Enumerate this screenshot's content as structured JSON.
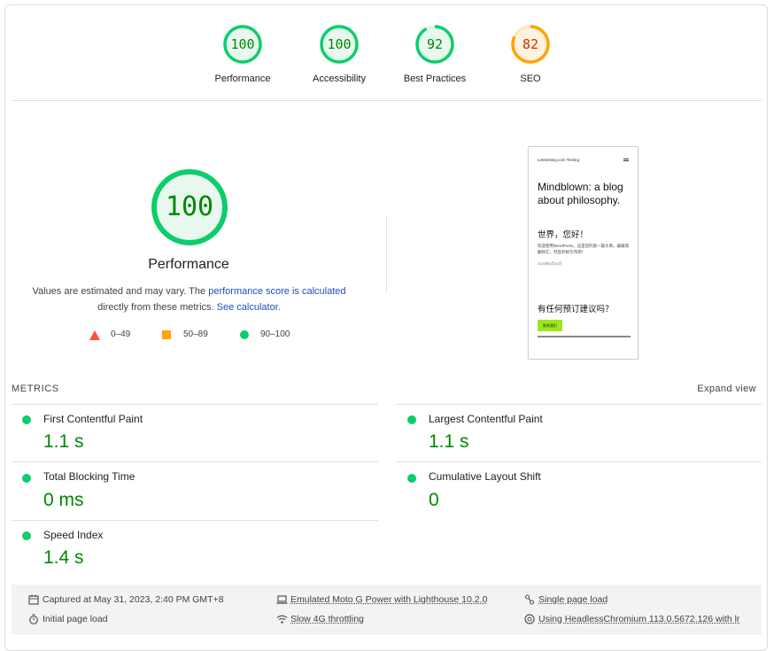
{
  "summary_gauges": [
    {
      "score": "100",
      "label": "Performance",
      "color": "#0cce6b",
      "fill": "#e8f8ef",
      "text_color": "#008800"
    },
    {
      "score": "100",
      "label": "Accessibility",
      "color": "#0cce6b",
      "fill": "#e8f8ef",
      "text_color": "#008800"
    },
    {
      "score": "92",
      "label": "Best Practices",
      "color": "#0cce6b",
      "fill": "#e8f8ef",
      "text_color": "#008800"
    },
    {
      "score": "82",
      "label": "SEO",
      "color": "#ffa400",
      "fill": "#fff3e0",
      "text_color": "#c33300"
    }
  ],
  "performance": {
    "score": "100",
    "title": "Performance",
    "desc_prefix": "Values are estimated and may vary. The ",
    "desc_link1": "performance score is calculated",
    "desc_middle": " directly from these metrics. ",
    "desc_link2": "See calculator.",
    "legend": [
      {
        "range": "0–49",
        "icon": "triangle-icon",
        "color": "#ff4e42"
      },
      {
        "range": "50–89",
        "icon": "square-icon",
        "color": "#ffa400"
      },
      {
        "range": "90–100",
        "icon": "circle-icon",
        "color": "#0cce6b"
      }
    ]
  },
  "screenshot": {
    "site_name": "Letstesting.com Testing",
    "menu_icon": "hamburger-icon",
    "headline": "Mindblown: a blog about philosophy.",
    "post_title": "世界，您好！",
    "post_excerpt": "欢迎使用WordPress。这是您的第一篇文章。编辑或删除它，然后开始写作吧！",
    "post_date": "2023年5月31日",
    "cta_heading": "有任何预订建议吗？",
    "cta_button": "联系我们",
    "cta_color": "#9be91a"
  },
  "metrics": {
    "heading": "METRICS",
    "expand_label": "Expand view",
    "items": [
      {
        "name": "First Contentful Paint",
        "value": "1.1 s"
      },
      {
        "name": "Largest Contentful Paint",
        "value": "1.1 s"
      },
      {
        "name": "Total Blocking Time",
        "value": "0 ms"
      },
      {
        "name": "Cumulative Layout Shift",
        "value": "0"
      },
      {
        "name": "Speed Index",
        "value": "1.4 s"
      }
    ]
  },
  "footer": {
    "captured": "Captured at May 31, 2023, 2:40 PM GMT+8",
    "initial_load": "Initial page load",
    "device": "Emulated Moto G Power with Lighthouse 10.2.0",
    "throttling": "Slow 4G throttling",
    "session": "Single page load",
    "browser": "Using HeadlessChromium 113.0.5672.126 with lr"
  }
}
